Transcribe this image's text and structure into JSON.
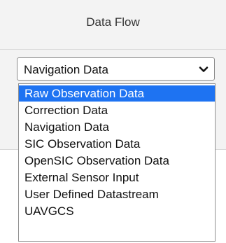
{
  "header": {
    "title": "Data Flow"
  },
  "select": {
    "value": "Navigation Data",
    "icon": "chevron-down-icon"
  },
  "dropdown": {
    "selected_option": "Raw Observation Data",
    "options": [
      "Raw Observation Data",
      "Correction Data",
      "Navigation Data",
      "SIC Observation Data",
      "OpenSIC Observation Data",
      "External Sensor Input",
      "User Defined Datastream",
      "UAVGCS"
    ]
  },
  "colors": {
    "highlight": "#1e73f2",
    "panel_background": "#f3f3f3"
  }
}
